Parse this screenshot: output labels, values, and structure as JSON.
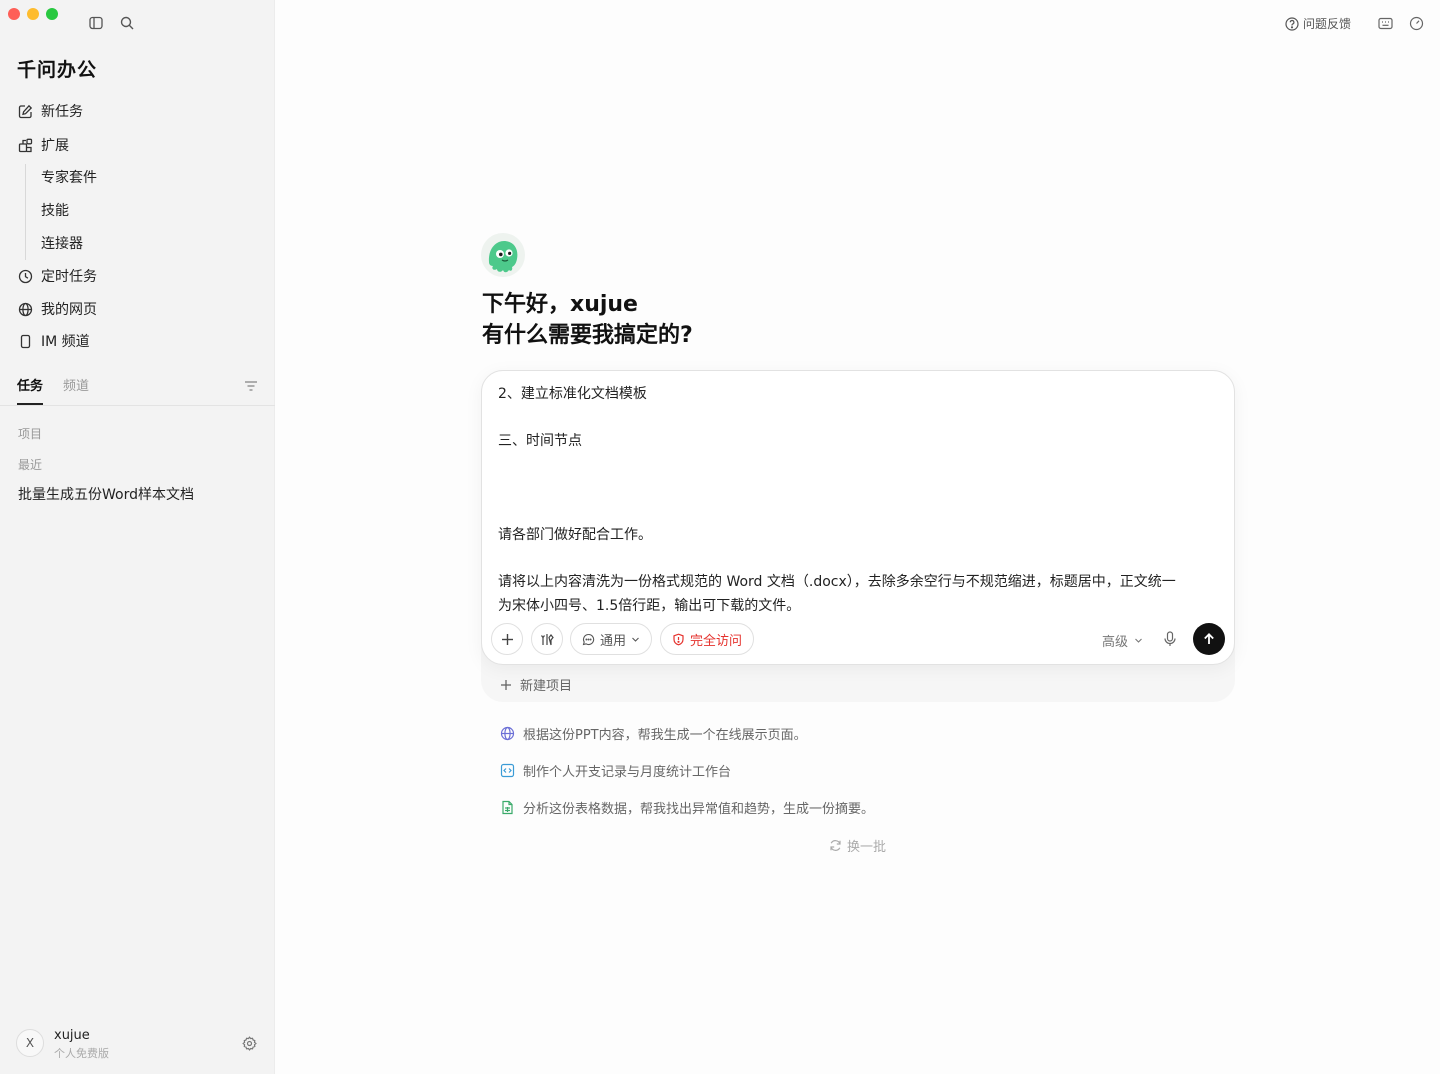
{
  "window": {
    "app_title": "千问办公"
  },
  "sidebar": {
    "nav": [
      {
        "label": "新任务",
        "icon": "edit-icon"
      },
      {
        "label": "扩展",
        "icon": "extensions-icon"
      }
    ],
    "sub_items": [
      "专家套件",
      "技能",
      "连接器"
    ],
    "nav2": [
      {
        "label": "定时任务",
        "icon": "clock-icon"
      },
      {
        "label": "我的网页",
        "icon": "globe-icon"
      },
      {
        "label": "IM 频道",
        "icon": "phone-icon"
      }
    ],
    "tabs": [
      "任务",
      "频道"
    ],
    "sections": {
      "projects": "项目",
      "recent": "最近"
    },
    "recent_items": [
      "批量生成五份Word样本文档"
    ],
    "user": {
      "avatar": "X",
      "name": "xujue",
      "plan": "个人免费版"
    }
  },
  "header": {
    "feedback_label": "问题反馈"
  },
  "main": {
    "greeting_line1": "下午好，xujue",
    "greeting_line2": "有什么需要我搞定的?",
    "composer": {
      "lines": [
        "2、建立标准化文档模板",
        "三、时间节点",
        "请各部门做好配合工作。",
        "请将以上内容清洗为一份格式规范的 Word 文档（.docx），去除多余空行与不规范缩进，标题居中，正文统一",
        "为宋体小四号、1.5倍行距，输出可下载的文件。"
      ],
      "mode_label": "通用",
      "access_label": "完全访问",
      "advanced_label": "高级",
      "access_color": "#e5322d"
    },
    "new_project_label": "新建项目",
    "suggestions": [
      {
        "label": "根据这份PPT内容，帮我生成一个在线展示页面。",
        "icon": "globe-icon"
      },
      {
        "label": "制作个人开支记录与月度统计工作台",
        "icon": "code-icon"
      },
      {
        "label": "分析这份表格数据，帮我找出异常值和趋势，生成一份摘要。",
        "icon": "spreadsheet-icon"
      }
    ],
    "refresh_label": "换一批"
  }
}
